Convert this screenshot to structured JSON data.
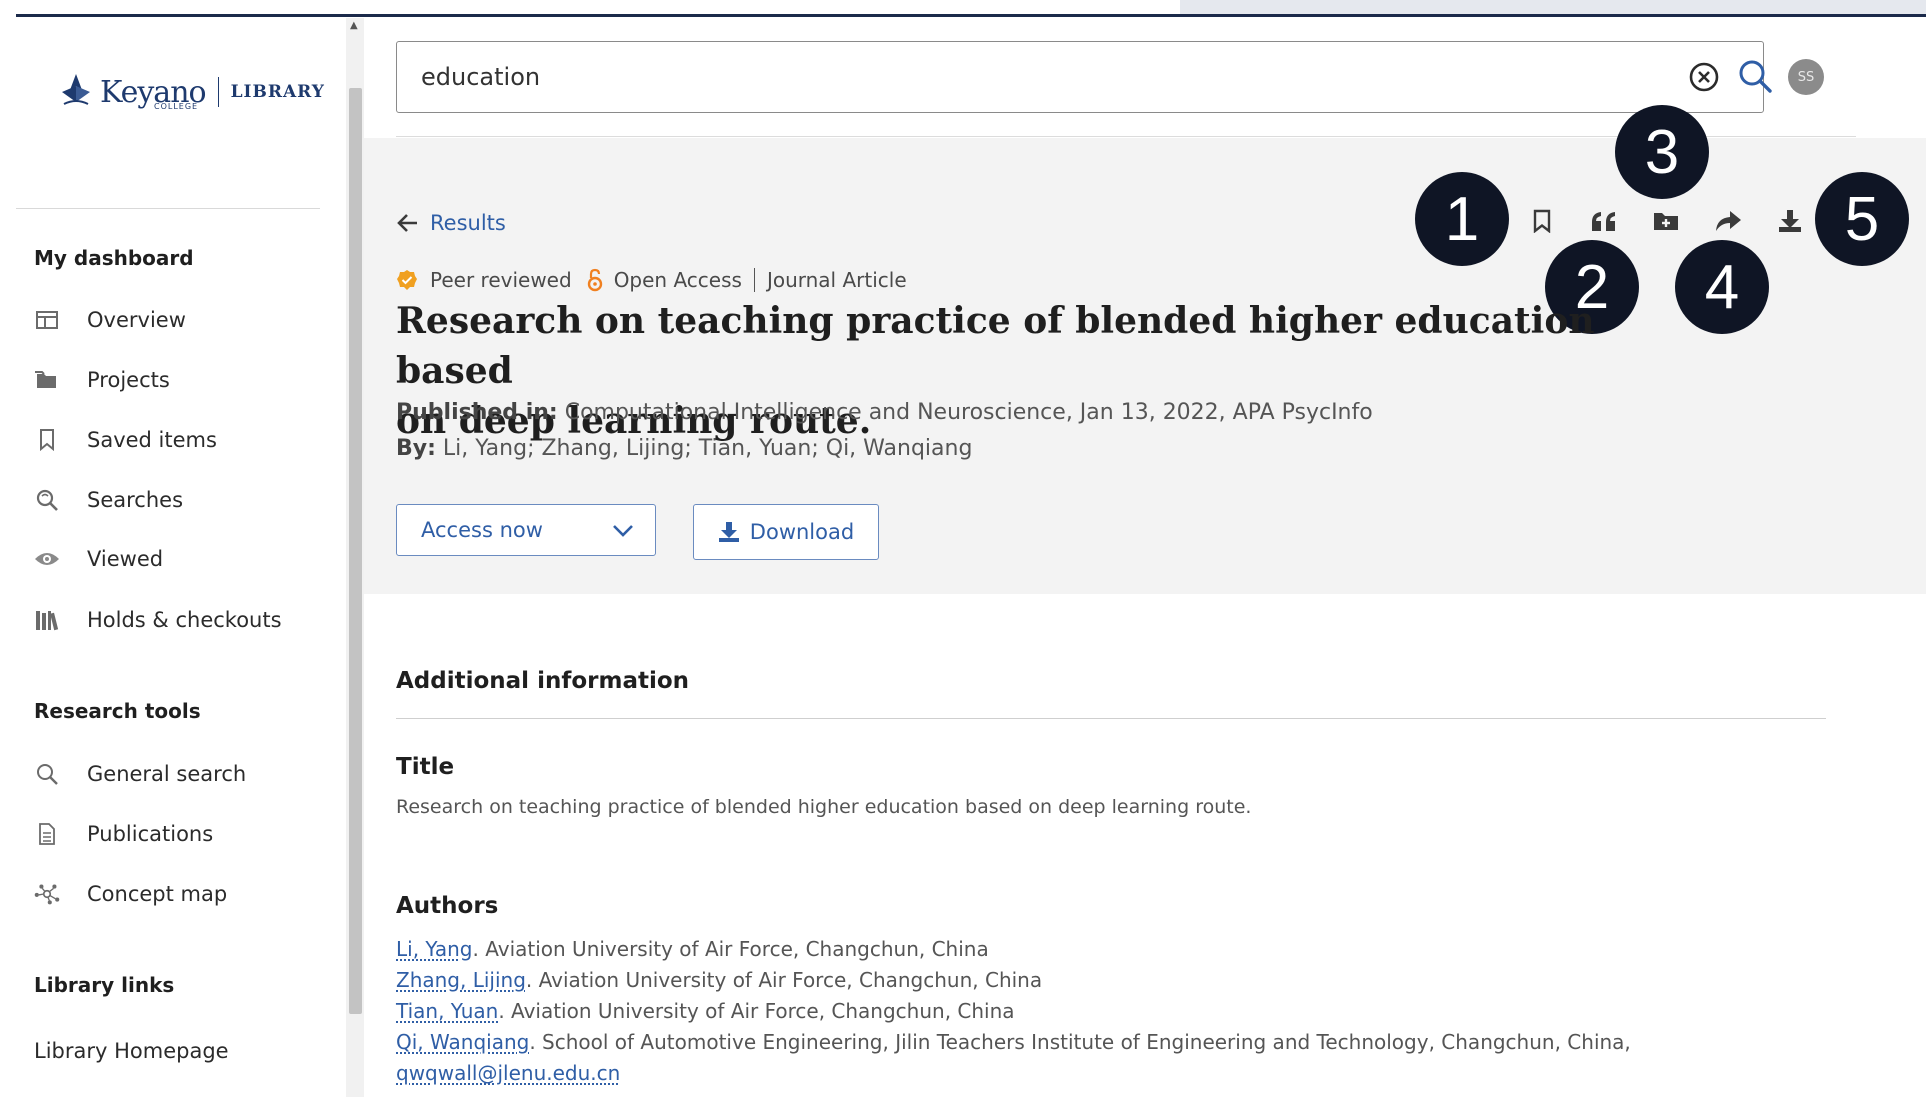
{
  "logo": {
    "name": "Keyano",
    "sub": "COLLEGE",
    "library": "LIBRARY"
  },
  "sidebar": {
    "dashboard_heading": "My dashboard",
    "dashboard_items": [
      {
        "label": "Overview",
        "icon": "overview-icon"
      },
      {
        "label": "Projects",
        "icon": "projects-icon"
      },
      {
        "label": "Saved items",
        "icon": "bookmark-icon"
      },
      {
        "label": "Searches",
        "icon": "search-history-icon"
      },
      {
        "label": "Viewed",
        "icon": "eye-icon"
      },
      {
        "label": "Holds & checkouts",
        "icon": "books-icon"
      }
    ],
    "tools_heading": "Research tools",
    "tools_items": [
      {
        "label": "General search",
        "icon": "search-icon"
      },
      {
        "label": "Publications",
        "icon": "document-icon"
      },
      {
        "label": "Concept map",
        "icon": "concept-map-icon"
      }
    ],
    "links_heading": "Library links",
    "links_items": [
      {
        "label": "Library Homepage"
      }
    ]
  },
  "search": {
    "value": "education"
  },
  "user": {
    "initials": "SS"
  },
  "record": {
    "back_label": "Results",
    "peer_reviewed": "Peer reviewed",
    "open_access": "Open Access",
    "type": "Journal Article",
    "title_line1": "Research on teaching practice of blended higher education based",
    "title_line2": "on deep learning route.",
    "published_label": "Published in:",
    "published_value": "Computational Intelligence and Neuroscience, Jan 13, 2022, APA PsycInfo",
    "by_label": "By:",
    "by_value": "Li, Yang; Zhang, Lijing; Tian, Yuan; Qi, Wanqiang",
    "access_label": "Access now",
    "download_label": "Download"
  },
  "toolbar": {
    "icons": [
      "bookmark-icon",
      "quote-icon",
      "add-folder-icon",
      "share-icon",
      "download-icon"
    ]
  },
  "callouts": [
    "1",
    "2",
    "3",
    "4",
    "5"
  ],
  "additional": {
    "heading": "Additional information",
    "title_heading": "Title",
    "title_value": "Research on teaching practice of blended higher education based on deep learning route.",
    "authors_heading": "Authors",
    "authors": [
      {
        "name": "Li, Yang",
        "affil": ". Aviation University of Air Force, Changchun, China"
      },
      {
        "name": "Zhang, Lijing",
        "affil": ". Aviation University of Air Force, Changchun, China"
      },
      {
        "name": "Tian, Yuan",
        "affil": ". Aviation University of Air Force, Changchun, China"
      },
      {
        "name": "Qi, Wanqiang",
        "affil": ". School of Automotive Engineering, Jilin Teachers Institute of Engineering and Technology, Changchun, China,"
      }
    ],
    "email": "qwqwall@jlenu.edu.cn"
  },
  "colors": {
    "accent": "#2f5ea6",
    "navy": "#1b2a4a",
    "callout": "#0f1525",
    "panel": "#f3f3f3",
    "peer_badge": "#f0a020"
  }
}
